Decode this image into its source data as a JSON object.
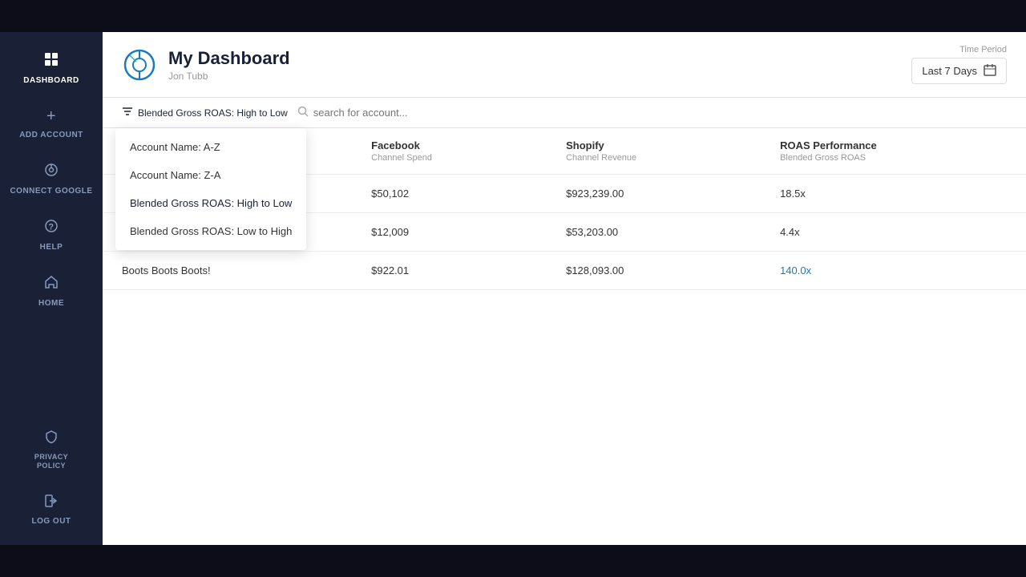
{
  "topbar": {},
  "sidebar": {
    "items": [
      {
        "id": "dashboard",
        "label": "DASHBOARD",
        "icon": "⊞",
        "active": true
      },
      {
        "id": "add-account",
        "label": "ADD ACCOUNT",
        "icon": "+"
      },
      {
        "id": "connect-google",
        "label": "CONNECT GOOGLE",
        "icon": "G"
      },
      {
        "id": "help",
        "label": "HELP",
        "icon": "?"
      },
      {
        "id": "home",
        "label": "HOME",
        "icon": "⌂"
      }
    ],
    "bottom_items": [
      {
        "id": "privacy-policy",
        "label": "PRIVACY POLICY",
        "icon": "🛡"
      },
      {
        "id": "log-out",
        "label": "LOG OUT",
        "icon": "⎋"
      }
    ]
  },
  "header": {
    "title": "My Dashboard",
    "subtitle": "Jon Tubb",
    "time_period_label": "Time Period",
    "time_period_value": "Last 7 Days"
  },
  "toolbar": {
    "sort_label": "Blended Gross ROAS: High to Low",
    "search_placeholder": "search for account..."
  },
  "dropdown": {
    "items": [
      {
        "id": "name-az",
        "label": "Account Name: A-Z"
      },
      {
        "id": "name-za",
        "label": "Account Name: Z-A"
      },
      {
        "id": "roas-high-low",
        "label": "Blended Gross ROAS: High to Low",
        "active": true
      },
      {
        "id": "roas-low-high",
        "label": "Blended Gross ROAS: Low to High"
      }
    ]
  },
  "table": {
    "columns": [
      {
        "id": "account",
        "label": "",
        "sublabel": ""
      },
      {
        "id": "facebook",
        "label": "Facebook",
        "sublabel": "Channel Spend"
      },
      {
        "id": "shopify",
        "label": "Shopify",
        "sublabel": "Channel Revenue"
      },
      {
        "id": "roas",
        "label": "ROAS Performance",
        "sublabel": "Blended Gross ROAS"
      }
    ],
    "rows": [
      {
        "account": "",
        "facebook": "$50,102",
        "shopify": "$923,239.00",
        "roas": "18.5x",
        "roas_highlight": false
      },
      {
        "account": "",
        "facebook": "$12,009",
        "shopify": "$53,203.00",
        "roas": "4.4x",
        "roas_highlight": false
      },
      {
        "account": "Boots Boots Boots!",
        "facebook": "$922.01",
        "shopify": "$128,093.00",
        "roas": "140.0x",
        "roas_highlight": true
      }
    ]
  },
  "icons": {
    "dashboard": "⊞",
    "add": "＋",
    "google": "G",
    "help": "？",
    "home": "⌂",
    "shield": "🛡",
    "logout": "↪",
    "calendar": "📅",
    "filter": "⇅",
    "search": "🔍"
  }
}
